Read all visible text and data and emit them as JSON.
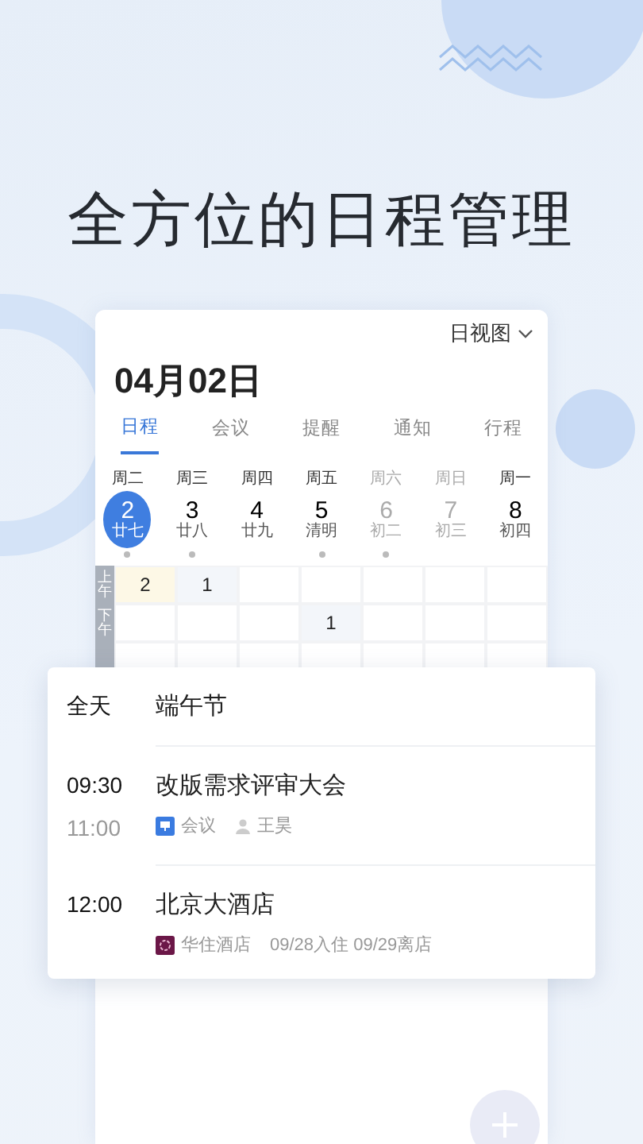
{
  "headline": "全方位的日程管理",
  "calendar": {
    "view_menu": "日视图",
    "date": "04月02日",
    "tabs": [
      {
        "label": "日程",
        "selected": true
      },
      {
        "label": "会议",
        "selected": false
      },
      {
        "label": "提醒",
        "selected": false
      },
      {
        "label": "通知",
        "selected": false
      },
      {
        "label": "行程",
        "selected": false
      }
    ],
    "days": [
      {
        "weekday": "周二",
        "day": "2",
        "lunar": "廿七",
        "selected": true,
        "weekend": false,
        "has_events": true
      },
      {
        "weekday": "周三",
        "day": "3",
        "lunar": "廿八",
        "selected": false,
        "weekend": false,
        "has_events": true
      },
      {
        "weekday": "周四",
        "day": "4",
        "lunar": "廿九",
        "selected": false,
        "weekend": false,
        "has_events": false
      },
      {
        "weekday": "周五",
        "day": "5",
        "lunar": "清明",
        "selected": false,
        "weekend": false,
        "has_events": true
      },
      {
        "weekday": "周六",
        "day": "6",
        "lunar": "初二",
        "selected": false,
        "weekend": true,
        "has_events": true
      },
      {
        "weekday": "周日",
        "day": "7",
        "lunar": "初三",
        "selected": false,
        "weekend": true,
        "has_events": false
      },
      {
        "weekday": "周一",
        "day": "8",
        "lunar": "初四",
        "selected": false,
        "weekend": false,
        "has_events": false
      }
    ],
    "slots": [
      {
        "label": "上午",
        "cells": [
          {
            "count": "2",
            "highlighted": true
          },
          {
            "count": "1",
            "highlighted": true
          },
          {
            "highlighted": false
          },
          {
            "highlighted": false
          },
          {
            "highlighted": false
          },
          {
            "highlighted": false
          },
          {
            "highlighted": false
          }
        ]
      },
      {
        "label": "下午",
        "cells": [
          {
            "highlighted": false
          },
          {
            "highlighted": false
          },
          {
            "highlighted": false
          },
          {
            "count": "1",
            "highlighted": true
          },
          {
            "highlighted": false
          },
          {
            "highlighted": false
          },
          {
            "highlighted": false
          }
        ]
      }
    ]
  },
  "events": [
    {
      "kind": "all_day",
      "time": "全天",
      "title": "端午节"
    },
    {
      "kind": "timed",
      "start": "09:30",
      "end": "11:00",
      "title": "改版需求评审大会",
      "source": {
        "kind": "meeting",
        "label": "会议"
      },
      "person": "王昊"
    },
    {
      "kind": "timed",
      "start": "12:00",
      "title": "北京大酒店",
      "source": {
        "kind": "hotel",
        "label": "华住酒店"
      },
      "detail": "09/28入住 09/29离店"
    }
  ]
}
